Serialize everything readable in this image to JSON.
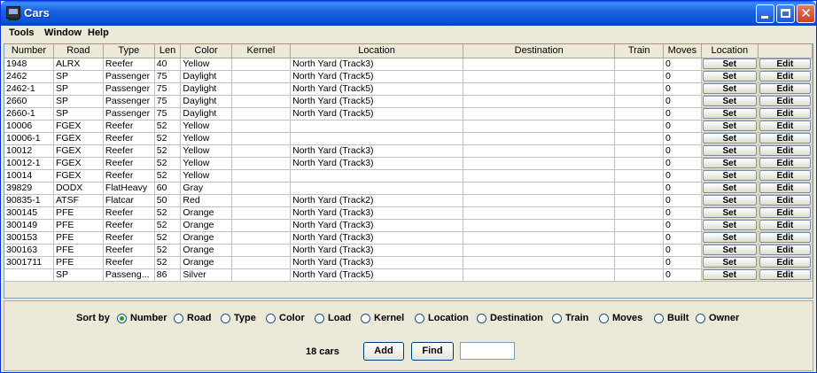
{
  "window": {
    "title": "Cars",
    "accent": "#0a5ae5"
  },
  "menu": [
    "Tools",
    "Window",
    "Help"
  ],
  "table": {
    "columns": [
      "Number",
      "Road",
      "Type",
      "Len",
      "Color",
      "Kernel",
      "Location",
      "Destination",
      "Train",
      "Moves",
      "Location",
      ""
    ],
    "set_label": "Set",
    "edit_label": "Edit",
    "rows": [
      {
        "number": "1948",
        "road": "ALRX",
        "type": "Reefer",
        "len": "40",
        "color": "Yellow",
        "kernel": "",
        "location": "North Yard (Track3)",
        "destination": "",
        "train": "",
        "moves": "0"
      },
      {
        "number": "2462",
        "road": "SP",
        "type": "Passenger",
        "len": "75",
        "color": "Daylight",
        "kernel": "",
        "location": "North Yard (Track5)",
        "destination": "",
        "train": "",
        "moves": "0"
      },
      {
        "number": "2462-1",
        "road": "SP",
        "type": "Passenger",
        "len": "75",
        "color": "Daylight",
        "kernel": "",
        "location": "North Yard (Track5)",
        "destination": "",
        "train": "",
        "moves": "0"
      },
      {
        "number": "2660",
        "road": "SP",
        "type": "Passenger",
        "len": "75",
        "color": "Daylight",
        "kernel": "",
        "location": "North Yard (Track5)",
        "destination": "",
        "train": "",
        "moves": "0"
      },
      {
        "number": "2660-1",
        "road": "SP",
        "type": "Passenger",
        "len": "75",
        "color": "Daylight",
        "kernel": "",
        "location": "North Yard (Track5)",
        "destination": "",
        "train": "",
        "moves": "0"
      },
      {
        "number": "10006",
        "road": "FGEX",
        "type": "Reefer",
        "len": "52",
        "color": "Yellow",
        "kernel": "",
        "location": "",
        "destination": "",
        "train": "",
        "moves": "0"
      },
      {
        "number": "10006-1",
        "road": "FGEX",
        "type": "Reefer",
        "len": "52",
        "color": "Yellow",
        "kernel": "",
        "location": "",
        "destination": "",
        "train": "",
        "moves": "0"
      },
      {
        "number": "10012",
        "road": "FGEX",
        "type": "Reefer",
        "len": "52",
        "color": "Yellow",
        "kernel": "",
        "location": "North Yard (Track3)",
        "destination": "",
        "train": "",
        "moves": "0"
      },
      {
        "number": "10012-1",
        "road": "FGEX",
        "type": "Reefer",
        "len": "52",
        "color": "Yellow",
        "kernel": "",
        "location": "North Yard (Track3)",
        "destination": "",
        "train": "",
        "moves": "0"
      },
      {
        "number": "10014",
        "road": "FGEX",
        "type": "Reefer",
        "len": "52",
        "color": "Yellow",
        "kernel": "",
        "location": "",
        "destination": "",
        "train": "",
        "moves": "0"
      },
      {
        "number": "39829",
        "road": "DODX",
        "type": "FlatHeavy",
        "len": "60",
        "color": "Gray",
        "kernel": "",
        "location": "",
        "destination": "",
        "train": "",
        "moves": "0"
      },
      {
        "number": "90835-1",
        "road": "ATSF",
        "type": "Flatcar",
        "len": "50",
        "color": "Red",
        "kernel": "",
        "location": "North Yard (Track2)",
        "destination": "",
        "train": "",
        "moves": "0"
      },
      {
        "number": "300145",
        "road": "PFE",
        "type": "Reefer",
        "len": "52",
        "color": "Orange",
        "kernel": "",
        "location": "North Yard (Track3)",
        "destination": "",
        "train": "",
        "moves": "0"
      },
      {
        "number": "300149",
        "road": "PFE",
        "type": "Reefer",
        "len": "52",
        "color": "Orange",
        "kernel": "",
        "location": "North Yard (Track3)",
        "destination": "",
        "train": "",
        "moves": "0"
      },
      {
        "number": "300153",
        "road": "PFE",
        "type": "Reefer",
        "len": "52",
        "color": "Orange",
        "kernel": "",
        "location": "North Yard (Track3)",
        "destination": "",
        "train": "",
        "moves": "0"
      },
      {
        "number": "300163",
        "road": "PFE",
        "type": "Reefer",
        "len": "52",
        "color": "Orange",
        "kernel": "",
        "location": "North Yard (Track3)",
        "destination": "",
        "train": "",
        "moves": "0"
      },
      {
        "number": "3001711",
        "road": "PFE",
        "type": "Reefer",
        "len": "52",
        "color": "Orange",
        "kernel": "",
        "location": "North Yard (Track3)",
        "destination": "",
        "train": "",
        "moves": "0"
      },
      {
        "number": "",
        "road": "SP",
        "type": "Passeng...",
        "len": "86",
        "color": "Silver",
        "kernel": "",
        "location": "North Yard (Track5)",
        "destination": "",
        "train": "",
        "moves": "0"
      }
    ]
  },
  "sort": {
    "label": "Sort by",
    "selected": "Number",
    "options": [
      "Number",
      "Road",
      "Type",
      "Color",
      "Load",
      "Kernel",
      "Location",
      "Destination",
      "Train",
      "Moves",
      "Built",
      "Owner"
    ]
  },
  "footer": {
    "count_text": "18 cars",
    "add_label": "Add",
    "find_label": "Find",
    "find_value": ""
  }
}
